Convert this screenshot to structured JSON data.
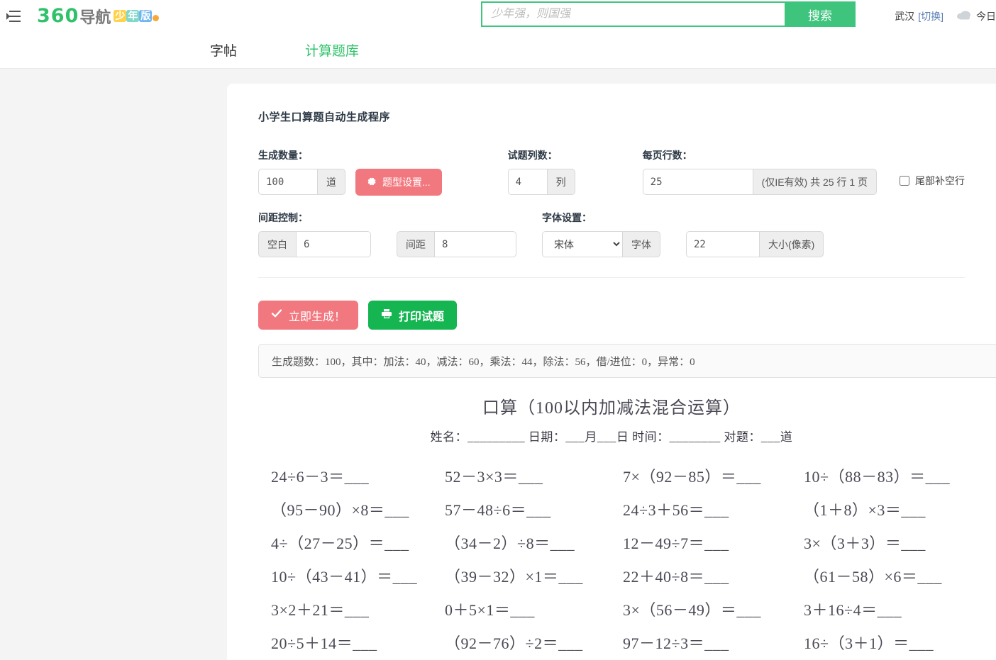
{
  "topbar": {
    "menu_icon": "hamburger-collapse-icon",
    "brand_360": "360",
    "brand_nav": "导航",
    "badge_1": "少",
    "badge_2": "年",
    "badge_3": "版",
    "search_placeholder": "少年强，则国强",
    "search_value": "",
    "search_button": "搜索",
    "city": "武汉",
    "switch": "[切换]",
    "weather_icon": "cloud-icon",
    "today": "今日"
  },
  "nav": {
    "tabs": [
      {
        "label": "字帖",
        "active": false
      },
      {
        "label": "计算题库",
        "active": true
      }
    ]
  },
  "form": {
    "app_title": "小学生口算题自动生成程序",
    "count_label": "生成数量：",
    "count_value": "100",
    "count_unit": "道",
    "settings_button": "题型设置...",
    "settings_icon": "gear-icon",
    "columns_label": "试题列数：",
    "columns_value": "4",
    "columns_unit": "列",
    "rows_label": "每页行数：",
    "rows_value": "25",
    "rows_suffix": "(仅IE有效) 共 25 行 1 页",
    "fill_blank_label": "尾部补空行",
    "fill_blank_checked": false,
    "spacing_label": "间距控制：",
    "blank_prefix": "空白",
    "blank_value": "6",
    "gap_prefix": "间距",
    "gap_value": "8",
    "font_label": "字体设置：",
    "font_selected": "宋体",
    "font_options": [
      "宋体"
    ],
    "font_addon": "字体",
    "size_value": "22",
    "size_addon": "大小(像素)"
  },
  "actions": {
    "generate_label": "立即生成！",
    "generate_icon": "check-icon",
    "print_label": "打印试题",
    "print_icon": "printer-icon"
  },
  "status": {
    "text": "生成题数：100，其中：加法：40，减法：60，乘法：44，除法：56，借/进位：0，异常：0"
  },
  "worksheet": {
    "title": "口算（100以内加减法混合运算）",
    "subline": "姓名：_________  日期：___月___日 时间：________ 对题：___道",
    "problems": [
      "24÷6－3＝___",
      "52－3×3＝___",
      "7×（92－85）＝___",
      "10÷（88－83）＝___",
      "（95－90）×8＝___",
      "57－48÷6＝___",
      "24÷3＋56＝___",
      "（1＋8）×3＝___",
      "4÷（27－25）＝___",
      "（34－2）÷8＝___",
      "12－49÷7＝___",
      "3×（3＋3）＝___",
      "10÷（43－41）＝___",
      "（39－32）×1＝___",
      "22＋40÷8＝___",
      "（61－58）×6＝___",
      "3×2＋21＝___",
      "0＋5×1＝___",
      "3×（56－49）＝___",
      "3＋16÷4＝___",
      "20÷5＋14＝___",
      "（92－76）÷2＝___",
      "97－12÷3＝___",
      "16÷（3＋1）＝___"
    ]
  },
  "colors": {
    "brand_green": "#2fc26a",
    "search_green": "#3fc47e",
    "pink": "#f1787f",
    "print_green": "#15b552",
    "page_bg": "#f4f4f4"
  }
}
